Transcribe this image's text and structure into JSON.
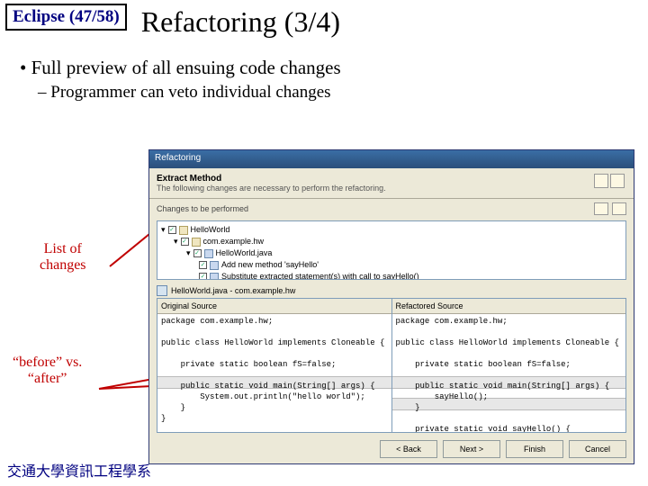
{
  "badge": {
    "product": "Eclipse",
    "progress": "(47/58)"
  },
  "title": "Refactoring (3/4)",
  "bullets": {
    "main": "Full preview of all ensuing code changes",
    "sub": "Programmer can veto individual changes"
  },
  "callouts": {
    "changes_l1": "List of",
    "changes_l2": "changes",
    "compare_l1": "“before” vs.",
    "compare_l2": "“after”"
  },
  "dialog": {
    "titlebar": "Refactoring",
    "section_title": "Extract Method",
    "section_desc": "The following changes are necessary to perform the refactoring.",
    "changes_label": "Changes to be performed",
    "tree": {
      "root": "HelloWorld",
      "pkg": "com.example.hw",
      "file": "HelloWorld.java",
      "m1": "Add new method 'sayHello'",
      "m2": "Substitute extracted statement(s) with call to sayHello()"
    },
    "compare_header": "HelloWorld.java - com.example.hw",
    "panes": {
      "left_header": "Original Source",
      "right_header": "Refactored Source",
      "left_code": "package com.example.hw;\n\npublic class HelloWorld implements Cloneable {\n\n    private static boolean fS=false;\n\n    public static void main(String[] args) {\n        System.out.println(\"hello world\");\n    }\n}",
      "right_code": "package com.example.hw;\n\npublic class HelloWorld implements Cloneable {\n\n    private static boolean fS=false;\n\n    public static void main(String[] args) {\n        sayHello();\n    }\n\n    private static void sayHello() {"
    },
    "buttons": {
      "back": "< Back",
      "next": "Next >",
      "finish": "Finish",
      "cancel": "Cancel"
    }
  },
  "footer": "交通大學資訊工程學系"
}
